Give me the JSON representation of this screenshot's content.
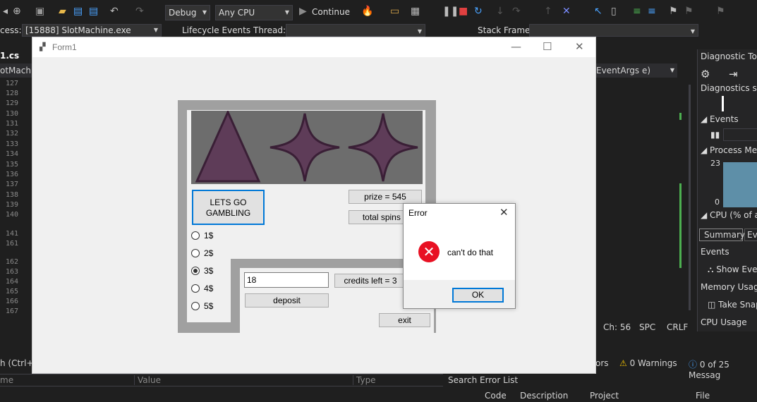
{
  "ide": {
    "config": "Debug",
    "platform": "Any CPU",
    "continue_label": "Continue",
    "process_label": "cess:",
    "process_value": "[15888] SlotMachine.exe",
    "lifecycle_label": "Lifecycle Events",
    "thread_label": "Thread:",
    "stack_frame_label": "Stack Frame:",
    "file_tab": "1.cs",
    "class_combo": "otMachin",
    "method_combo": "EventArgs e)",
    "line_numbers": [
      "127",
      "128",
      "129",
      "130",
      "131",
      "132",
      "133",
      "134",
      "135",
      "136",
      "137",
      "138",
      "139",
      "140",
      "141",
      "161",
      "162",
      "163",
      "164",
      "165",
      "166",
      "167"
    ],
    "status": {
      "ch": "Ch: 56",
      "spc": "SPC",
      "crlf": "CRLF"
    },
    "search_label": "h (Ctrl+E",
    "locals_headers": {
      "name": "me",
      "value": "Value",
      "type": "Type"
    },
    "errors_tab": "ors",
    "warnings": "0 Warnings",
    "messages": "0 of 25 Messag",
    "search_error_list": "Search Error List",
    "error_columns": [
      "Code",
      "Description",
      "Project",
      "File"
    ]
  },
  "diagnostics": {
    "title": "Diagnostic Tool",
    "session": "Diagnostics se",
    "events": "Events",
    "process_memory": "Process Mem",
    "mem_max": "23",
    "mem_min": "0",
    "cpu": "CPU (% of all",
    "tab_summary": "Summary",
    "tab_ev": "Ev",
    "events_header": "Events",
    "show_events": "Show Eve",
    "memory_usage": "Memory Usage",
    "take_snapshot": "Take Snap",
    "cpu_usage": "CPU Usage"
  },
  "form": {
    "title": "Form1",
    "gamble_button": "LETS GO\nGAMBLING",
    "prize": "prize = 545",
    "total_spins": "total spins =",
    "bets": [
      "1$",
      "2$",
      "3$",
      "4$",
      "5$"
    ],
    "selected_bet": "3$",
    "deposit_value": "18",
    "credits": "credits left = 3",
    "deposit_button": "deposit",
    "exit_button": "exit",
    "reels": [
      "triangle",
      "star",
      "star"
    ],
    "reel_color": "#5e3c58"
  },
  "dialog": {
    "title": "Error",
    "message": "can't do that",
    "ok": "OK"
  }
}
